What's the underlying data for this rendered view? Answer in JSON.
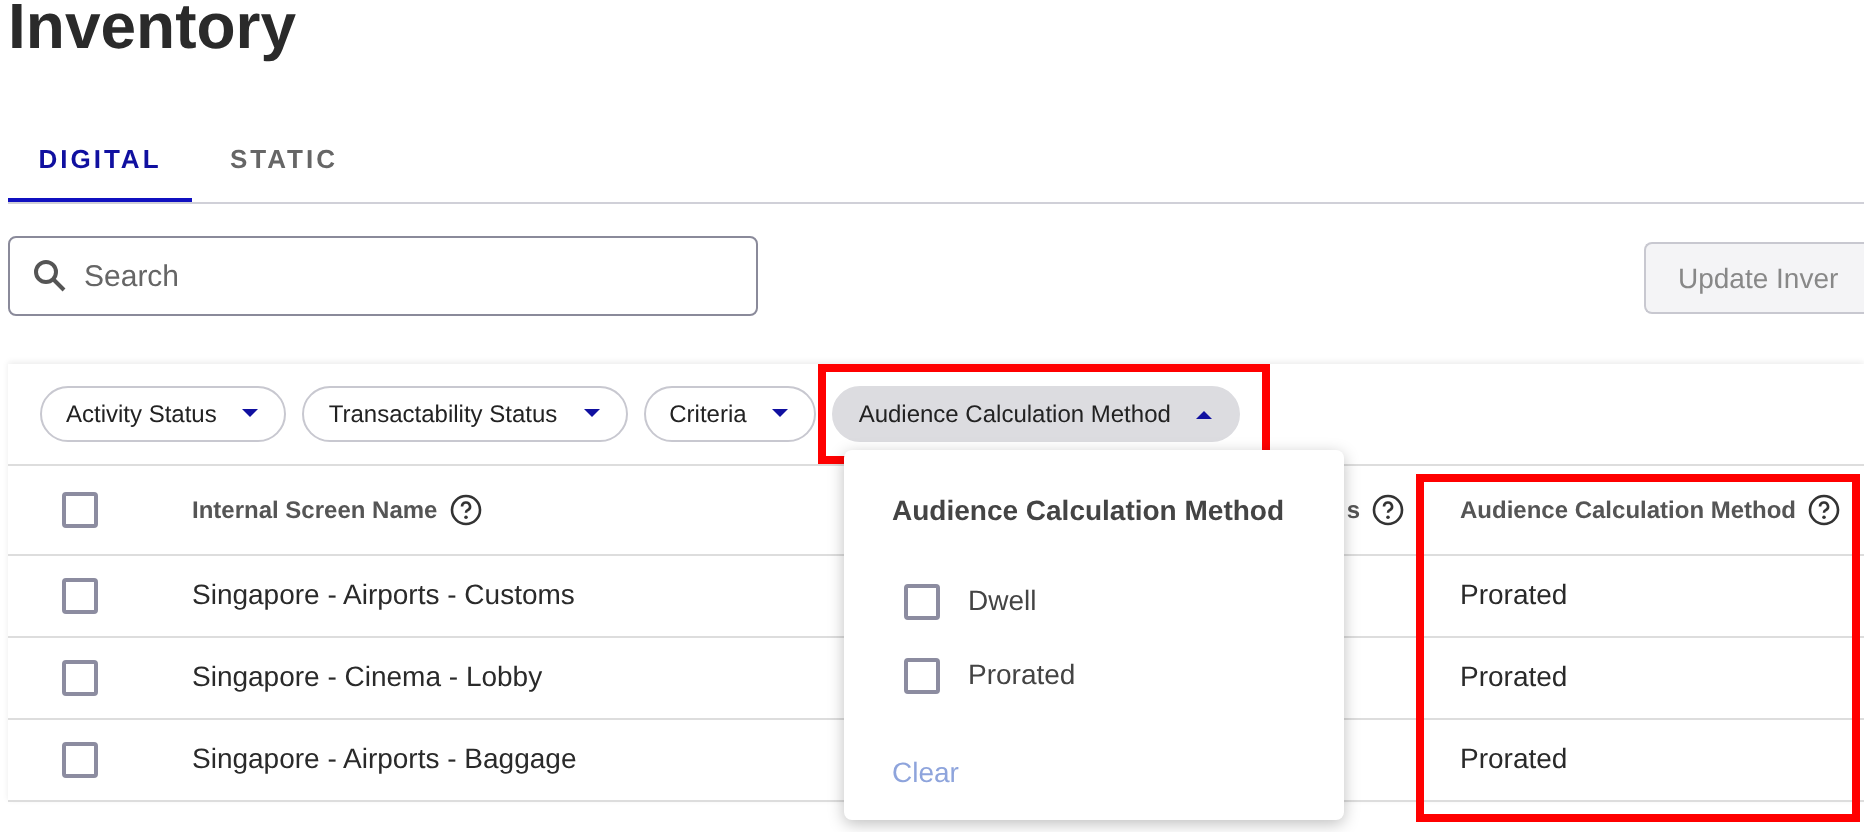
{
  "page": {
    "title": "Inventory"
  },
  "tabs": [
    {
      "label": "DIGITAL",
      "selected": true
    },
    {
      "label": "STATIC",
      "selected": false
    }
  ],
  "search": {
    "placeholder": "Search"
  },
  "update_button": {
    "label": "Update Inver",
    "disabled": true
  },
  "filters": [
    {
      "label": "Activity Status",
      "open": false,
      "highlighted": false
    },
    {
      "label": "Transactability Status",
      "open": false,
      "highlighted": false
    },
    {
      "label": "Criteria",
      "open": false,
      "highlighted": false
    },
    {
      "label": "Audience Calculation Method",
      "open": true,
      "highlighted": true
    }
  ],
  "filter_menu": {
    "title": "Audience Calculation Method",
    "options": [
      {
        "label": "Dwell",
        "checked": false
      },
      {
        "label": "Prorated",
        "checked": false
      }
    ],
    "clear": {
      "label": "Clear",
      "disabled": true
    }
  },
  "table": {
    "select_all": {
      "checked": false
    },
    "columns": [
      {
        "label": "Internal Screen Name",
        "highlighted": false
      },
      {
        "label": "s",
        "highlighted": false
      },
      {
        "label": "Audience Calculation Method",
        "highlighted": true
      }
    ],
    "rows": [
      {
        "checked": false,
        "cells": [
          "Singapore - Airports - Customs",
          "",
          "Prorated"
        ]
      },
      {
        "checked": false,
        "cells": [
          "Singapore - Cinema - Lobby",
          "",
          "Prorated"
        ]
      },
      {
        "checked": false,
        "cells": [
          "Singapore - Airports - Baggage",
          "",
          "Prorated"
        ]
      }
    ]
  }
}
